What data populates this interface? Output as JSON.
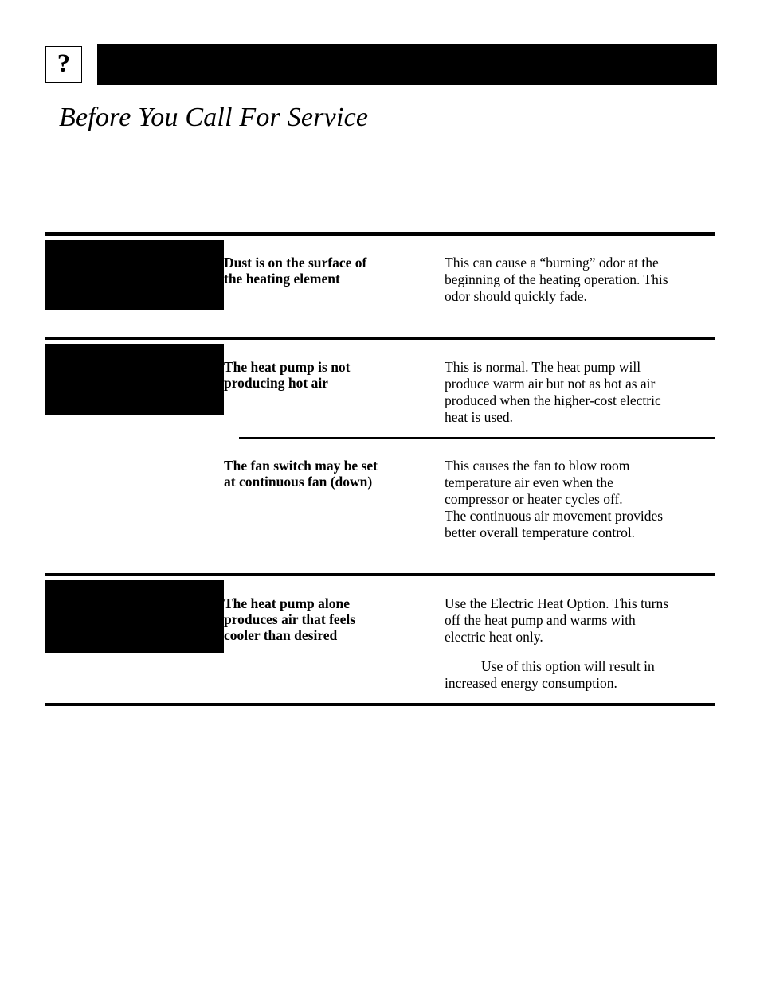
{
  "page": {
    "title": "Before You Call For Service",
    "badge_glyph": "?",
    "header_bar_label": "",
    "redacted_note": ""
  },
  "table": {
    "groups": [
      {
        "id": "group-odor",
        "cause_label": "",
        "rows": [
          {
            "problem": "Dust is on the surface of\nthe heating element",
            "solutions": [
              "This can cause a “burning” odor at the\nbeginning of the heating operation. This\nodor should quickly fade."
            ]
          }
        ]
      },
      {
        "id": "group-heat-pump",
        "cause_label": "",
        "rows": [
          {
            "problem": "The heat pump is not\nproducing hot air",
            "solutions": [
              "This is normal. The heat pump will\nproduce warm air but not as hot as air\nproduced when the higher-cost electric\nheat is used."
            ]
          },
          {
            "problem": "The fan switch may be set\nat continuous fan (down)",
            "solutions": [
              "This causes the fan to blow room\ntemperature air even when the\ncompressor or heater cycles off.\nThe continuous air movement provides\nbetter overall temperature control."
            ]
          }
        ]
      },
      {
        "id": "group-cooler-air",
        "cause_label": "",
        "rows": [
          {
            "problem": "The heat pump alone\nproduces air that feels\ncooler than desired",
            "solutions": [
              "Use the Electric Heat Option. This turns\noff the heat pump and warms with\nelectric heat only.",
              "Use of this option will result in\nincreased energy consumption."
            ]
          }
        ]
      }
    ]
  },
  "colors": {
    "ink": "#000000",
    "paper": "#ffffff"
  }
}
